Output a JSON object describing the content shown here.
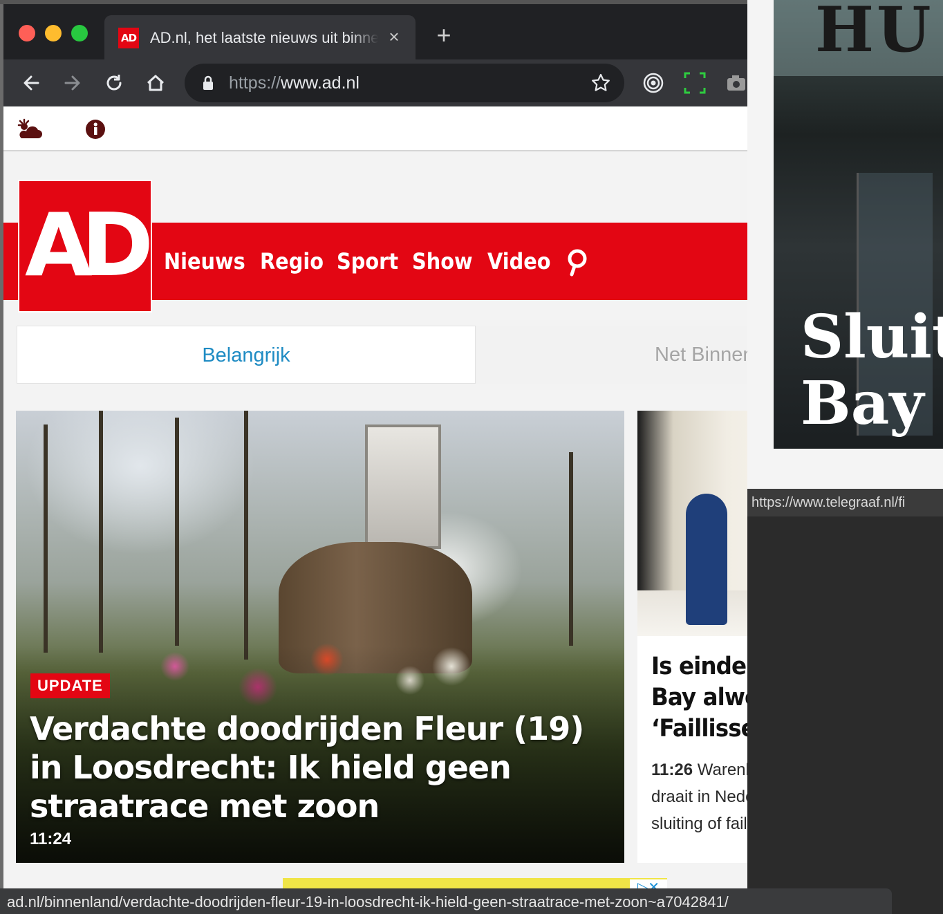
{
  "browser": {
    "tab": {
      "favicon": "AD",
      "title": "AD.nl, het laatste nieuws uit binnenland",
      "close": "×"
    },
    "new_tab": "+",
    "toolbar": {
      "back": "back-arrow-icon",
      "forward": "forward-arrow-icon",
      "reload": "reload-icon",
      "home": "home-icon",
      "url_scheme": "https://",
      "url_host": "www.ad.nl",
      "bookmark": "star-icon"
    }
  },
  "utility_bar": {
    "weather": "weather-icon",
    "info": "info-icon"
  },
  "site": {
    "logo": "AD",
    "nav": [
      "Nieuws",
      "Regio",
      "Sport",
      "Show",
      "Video"
    ],
    "accent": "#e30613"
  },
  "tabs": {
    "active": "Belangrijk",
    "inactive": "Net Binnen"
  },
  "lead_article": {
    "badge": "UPDATE",
    "title": "Verdachte doodrijden Fleur (19) in Loosdrecht: Ik hield geen straatrace met zoon",
    "time": "11:24"
  },
  "side_article": {
    "title": "Is einde Hudson's Bay alweer nabij? ‘Faillissement dreigt’",
    "time": "11:26",
    "summary": "Warenhuisketen Hudson's Bay draait in Nederland zo slecht dat een sluiting of faillissement..."
  },
  "background_window": {
    "headline": "Sluiti Bay",
    "status_url": "https://www.telegraaf.nl/fi"
  },
  "status_bar": {
    "url": "ad.nl/binnenland/verdachte-doodrijden-fleur-19-in-loosdrecht-ik-hield-geen-straatrace-met-zoon~a7042841/"
  }
}
